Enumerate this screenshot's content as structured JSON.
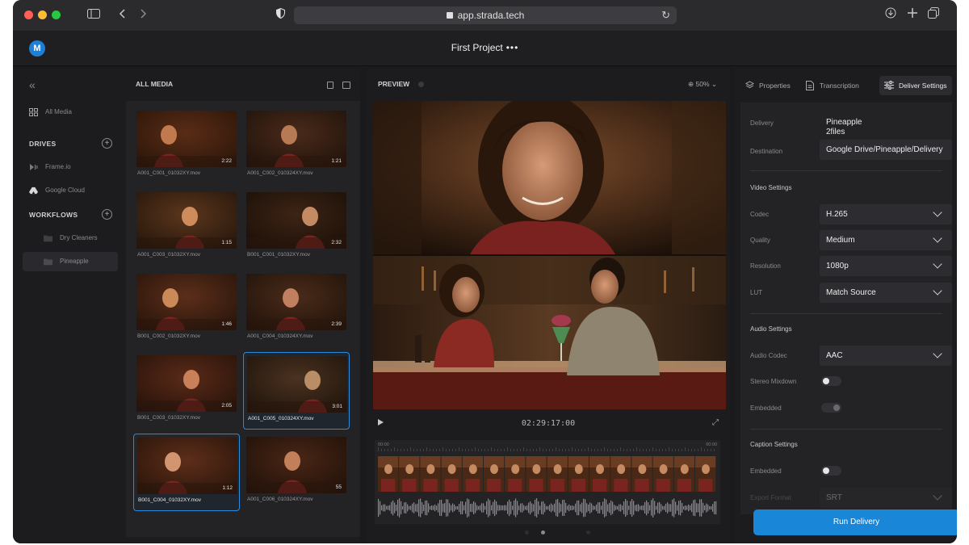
{
  "browser": {
    "url": "app.strada.tech",
    "traffic_colors": [
      "#ff5f57",
      "#febc2e",
      "#28c840"
    ]
  },
  "header": {
    "avatar_initial": "M",
    "project_title": "First Project",
    "more_label": "•••"
  },
  "sidebar": {
    "all_media": "All Media",
    "drives_title": "DRIVES",
    "drives": [
      "Frame.io",
      "Google Cloud"
    ],
    "workflows_title": "WORKFLOWS",
    "workflows": [
      "Dry Cleaners",
      "Pineapple"
    ],
    "selected_workflow": "Pineapple"
  },
  "media": {
    "title": "ALL MEDIA",
    "clips": [
      {
        "name": "A001_C001_01032XY.mov",
        "duration": "2:22",
        "selected": false
      },
      {
        "name": "A001_C002_010324XY.mov",
        "duration": "1:21",
        "selected": false
      },
      {
        "name": "A001_C003_01032XY.mov",
        "duration": "1:15",
        "selected": false
      },
      {
        "name": "B001_C001_01032XY.mov",
        "duration": "2:32",
        "selected": false
      },
      {
        "name": "B001_C002_01032XY.mov",
        "duration": "1:46",
        "selected": false
      },
      {
        "name": "A001_C004_010324XY.mov",
        "duration": "2:39",
        "selected": false
      },
      {
        "name": "B001_C003_01032XY.mov",
        "duration": "2:05",
        "selected": false
      },
      {
        "name": "A001_C005_010324XY.mov",
        "duration": "3:01",
        "selected": true
      },
      {
        "name": "B001_C004_01032XY.mov",
        "duration": "1:12",
        "selected": true
      },
      {
        "name": "A001_C006_010324XY.mov",
        "duration": "55",
        "selected": false
      }
    ]
  },
  "preview": {
    "title": "PREVIEW",
    "zoom": "50%",
    "timecode": "02:29:17:00",
    "timeline_start": "00:00",
    "timeline_end": "00:00"
  },
  "right_panel": {
    "tabs": [
      "Properties",
      "Transcription",
      "Deliver Settings"
    ],
    "active_tab": "Deliver Settings",
    "delivery_label": "Delivery",
    "delivery_name": "Pineapple",
    "delivery_files": "2files",
    "destination_label": "Destination",
    "destination": "Google Drive/Pineapple/Delivery",
    "video_settings_title": "Video Settings",
    "codec_label": "Codec",
    "codec": "H.265",
    "quality_label": "Quality",
    "quality": "Medium",
    "resolution_label": "Resolution",
    "resolution": "1080p",
    "lut_label": "LUT",
    "lut": "Match Source",
    "audio_settings_title": "Audio Settings",
    "audio_codec_label": "Audio Codec",
    "audio_codec": "AAC",
    "stereo_mixdown_label": "Stereo Mixdown",
    "stereo_mixdown_on": false,
    "embedded_label": "Embedded",
    "caption_settings_title": "Caption Settings",
    "caption_embedded_label": "Embedded",
    "export_format_label": "Export Format",
    "export_format": "SRT",
    "run_button": "Run Delivery"
  },
  "colors": {
    "accent": "#1a86d8",
    "selection_border": "#2b8ad8",
    "panel_bg": "#1c1c1f"
  }
}
